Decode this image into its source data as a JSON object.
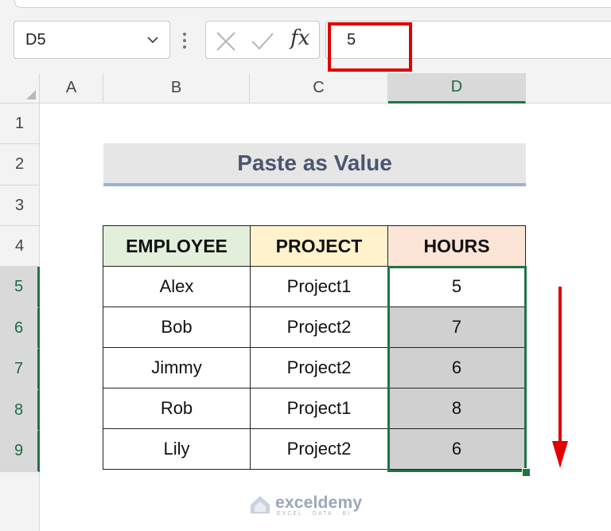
{
  "formula_bar": {
    "name_box": "D5",
    "fx_label": "fx",
    "formula_value": "5"
  },
  "columns": [
    "A",
    "B",
    "C",
    "D"
  ],
  "selected_column": "D",
  "rows": [
    "1",
    "2",
    "3",
    "4",
    "5",
    "6",
    "7",
    "8",
    "9"
  ],
  "selected_rows": [
    "5",
    "6",
    "7",
    "8",
    "9"
  ],
  "sheet": {
    "title": "Paste as Value",
    "table": {
      "headers": [
        "EMPLOYEE",
        "PROJECT",
        "HOURS"
      ],
      "header_colors": [
        "#e2efda",
        "#fff2cc",
        "#fce4d6"
      ],
      "rows": [
        [
          "Alex",
          "Project1",
          "5"
        ],
        [
          "Bob",
          "Project2",
          "7"
        ],
        [
          "Jimmy",
          "Project2",
          "6"
        ],
        [
          "Rob",
          "Project1",
          "8"
        ],
        [
          "Lily",
          "Project2",
          "6"
        ]
      ]
    }
  },
  "highlight_color": "#e00000",
  "selection_color": "#217346",
  "watermark": {
    "name": "exceldemy",
    "tagline": "EXCEL · DATA · BI"
  }
}
